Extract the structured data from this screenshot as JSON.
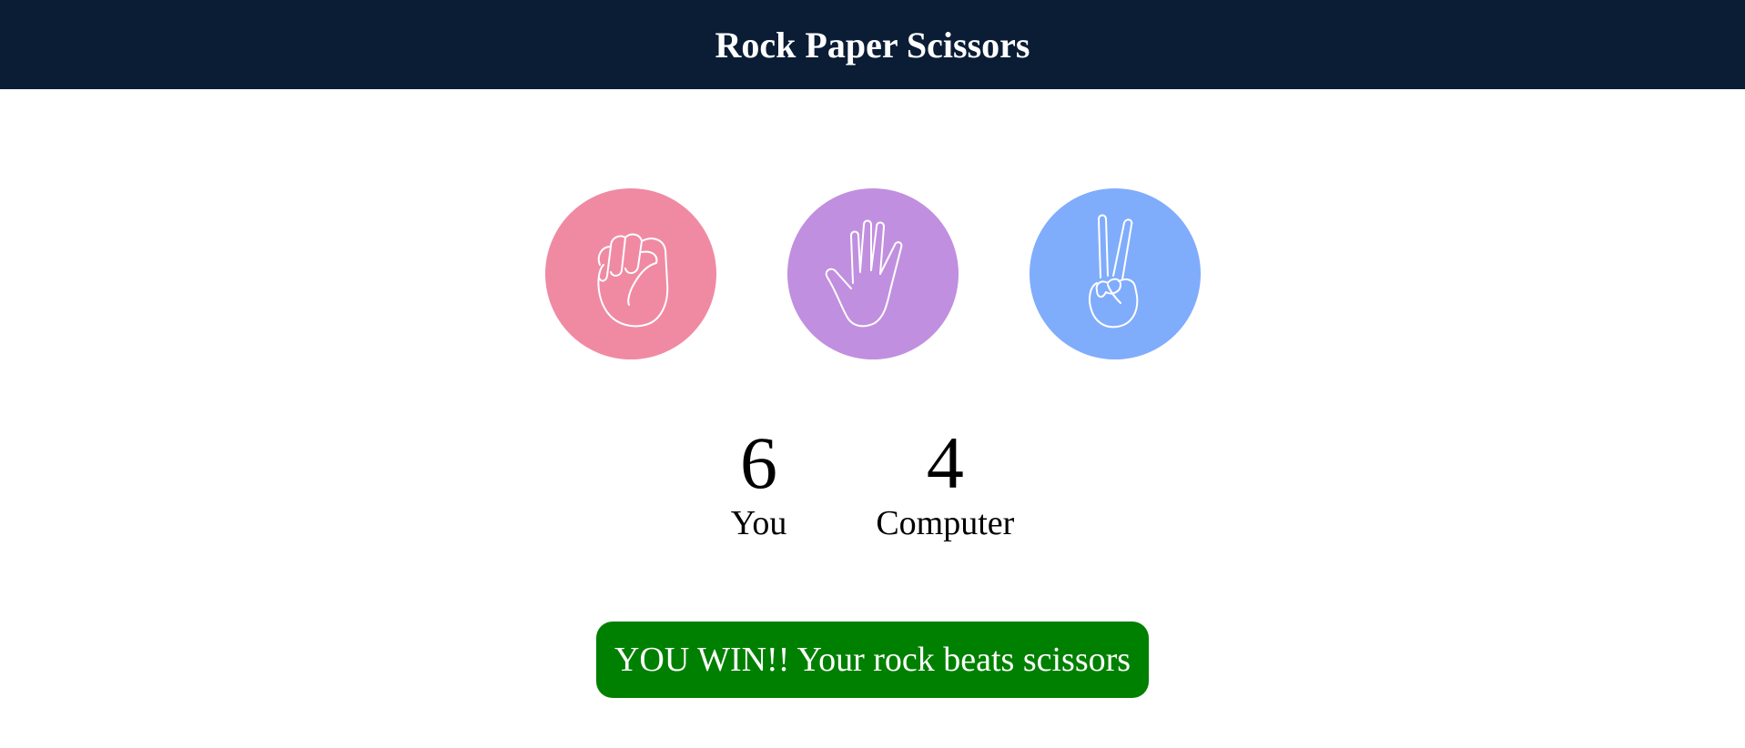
{
  "app": {
    "title": "Rock Paper Scissors",
    "header_color": "#0a1d35"
  },
  "choices": [
    {
      "name": "rock",
      "icon": "fist-icon",
      "color": "#f08aa3"
    },
    {
      "name": "paper",
      "icon": "open-hand-icon",
      "color": "#c18fdf"
    },
    {
      "name": "scissors",
      "icon": "peace-hand-icon",
      "color": "#80acfc"
    }
  ],
  "scores": {
    "player": {
      "value": "6",
      "label": "You"
    },
    "computer": {
      "value": "4",
      "label": "Computer"
    }
  },
  "result": {
    "text": "YOU WIN!! Your rock beats scissors",
    "color": "#008000"
  }
}
